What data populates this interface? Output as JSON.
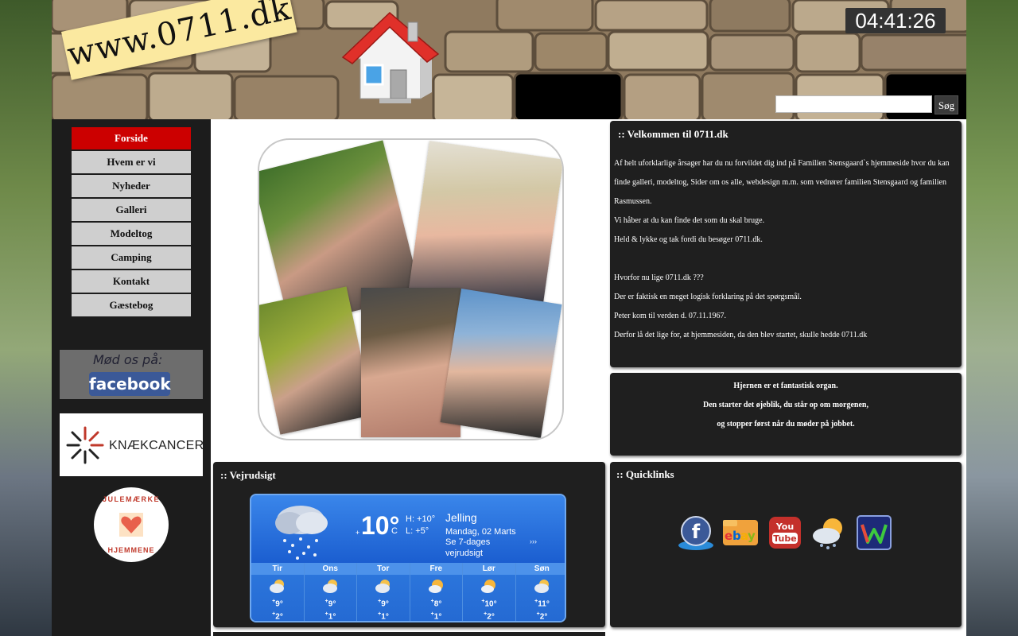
{
  "header": {
    "logo_text": "www.0711.dk",
    "clock": "04:41:26",
    "search_placeholder": "",
    "search_button": "Søg"
  },
  "menu": [
    {
      "label": "Forside",
      "active": true
    },
    {
      "label": "Hvem er vi"
    },
    {
      "label": "Nyheder"
    },
    {
      "label": "Galleri"
    },
    {
      "label": "Modeltog"
    },
    {
      "label": "Camping"
    },
    {
      "label": "Kontakt"
    },
    {
      "label": "Gæstebog"
    }
  ],
  "sidebar_badges": {
    "facebook_tagline": "Mød os på:",
    "facebook_label": "facebook",
    "cancer_label": "KNÆKCANCER",
    "julemaerke_top": "JULEMÆRKE",
    "julemaerke_bottom": "HJEMMENE"
  },
  "welcome": {
    "title": ":: Velkommen til 0711.dk",
    "paragraphs": [
      "Af helt uforklarlige årsager har du nu forvildet dig ind på Familien Stensgaard`s hjemmeside hvor du kan finde galleri, modeltog, Sider om os alle, webdesign m.m. som vedrører familien Stensgaard og familien Rasmussen.",
      "Vi håber at du kan finde det som du skal bruge.",
      "Held & lykke og tak fordi du besøger 0711.dk.",
      "",
      "Hvorfor nu lige 0711.dk ???",
      "Der er faktisk en meget logisk forklaring på det spørgsmål.",
      "Peter kom til verden d. 07.11.1967.",
      "Derfor lå det lige for, at hjemmesiden, da den blev startet, skulle hedde 0711.dk"
    ]
  },
  "quote": {
    "lines": [
      "Hjernen er et fantastisk organ.",
      "Den starter det øjeblik, du står op om morgenen,",
      "og stopper først når du møder på jobbet."
    ]
  },
  "weather": {
    "title": ":: Vejrudsigt",
    "temp": "10°",
    "temp_sign": "+",
    "unit": "C",
    "high": "H: +10°",
    "low": "L: +5°",
    "city": "Jelling",
    "date": "Mandag, 02 Marts",
    "forecast_link_1": "Se 7-dages",
    "forecast_link_2": "vejrudsigt",
    "days": [
      {
        "name": "Tir",
        "hi": "9°",
        "lo": "2°",
        "icon": "partly-cloudy-icon"
      },
      {
        "name": "Ons",
        "hi": "9°",
        "lo": "1°",
        "icon": "partly-cloudy-icon"
      },
      {
        "name": "Tor",
        "hi": "9°",
        "lo": "1°",
        "icon": "partly-cloudy-icon"
      },
      {
        "name": "Fre",
        "hi": "8°",
        "lo": "1°",
        "icon": "partly-sunny-icon"
      },
      {
        "name": "Lør",
        "hi": "10°",
        "lo": "2°",
        "icon": "partly-sunny-icon"
      },
      {
        "name": "Søn",
        "hi": "11°",
        "lo": "2°",
        "icon": "partly-cloudy-icon"
      }
    ]
  },
  "quicklinks": {
    "title": ":: Quicklinks",
    "items": [
      "facebook-icon",
      "ebay-icon",
      "youtube-icon",
      "weather-icon",
      "w-icon"
    ]
  },
  "colors": {
    "menu_active": "#cc0000",
    "box_bg": "#1f1f1f",
    "weather_blue": "#1a5fc8"
  }
}
